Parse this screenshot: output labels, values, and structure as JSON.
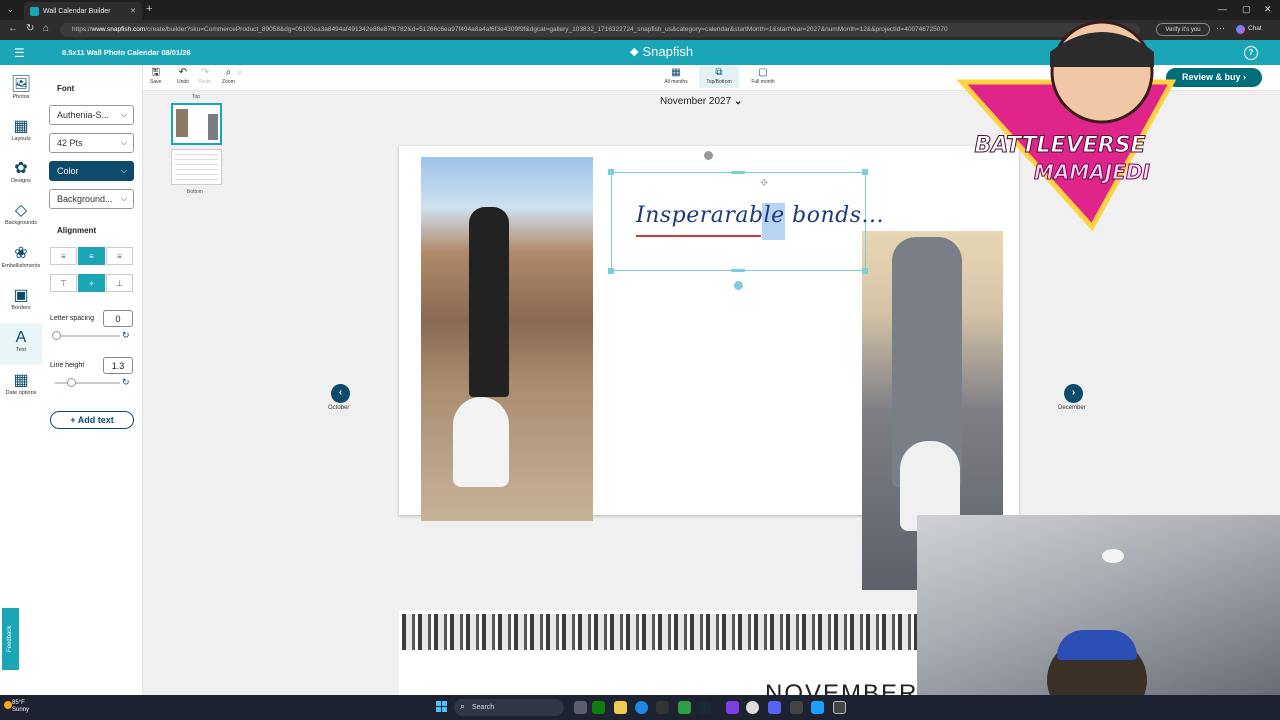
{
  "browser": {
    "tab_title": "Wall Calendar Builder",
    "url_prefix": "https://",
    "url_domain": "www.snapfish.com",
    "url_rest": "/create/builder?sku=CommerceProduct_89058&dg=05102ea3a8494af491342e88e87f6782&d=51266c6ea97f494a8a4af6f3e4309f9f&dgcat=gallery_103832_1716322724_snapfish_us&category=calendar&startMonth=1&startYear=2027&numMonth=12&&projectId=400746725070",
    "verify_label": "Verify it's you",
    "chat_label": "Chat"
  },
  "app": {
    "project_title": "8.5x11 Wall Photo Calendar  08/01/26",
    "brand": "Snapfish",
    "help_label": "?",
    "review_button": "Review & buy ›"
  },
  "rail": [
    {
      "label": "Photos",
      "icon": "photos-icon",
      "glyph": "🖼"
    },
    {
      "label": "Layouts",
      "icon": "layouts-icon",
      "glyph": "▦"
    },
    {
      "label": "Designs",
      "icon": "designs-icon",
      "glyph": "✿"
    },
    {
      "label": "Backgrounds",
      "icon": "backgrounds-icon",
      "glyph": "◇"
    },
    {
      "label": "Embellishments",
      "icon": "embellishments-icon",
      "glyph": "❀"
    },
    {
      "label": "Borders",
      "icon": "borders-icon",
      "glyph": "▣"
    },
    {
      "label": "Text",
      "icon": "text-icon",
      "glyph": "A"
    },
    {
      "label": "Date options",
      "icon": "calendar-icon",
      "glyph": "▦"
    }
  ],
  "panel": {
    "font_heading": "Font",
    "font_family": "Authenia-S...",
    "font_size": "42 Pts",
    "color_label": "Color",
    "background_label": "Background...",
    "alignment_heading": "Alignment",
    "letter_spacing_label": "Letter spacing",
    "letter_spacing_value": "0",
    "line_height_label": "Line height",
    "line_height_value": "1.3",
    "add_text": "+ Add text",
    "feedback": "Feedback"
  },
  "toolbar": {
    "save": "Save",
    "undo": "Undo",
    "redo": "Redo",
    "zoom": "Zoom",
    "views": [
      "All months",
      "Top/Bottom",
      "Full month"
    ]
  },
  "thumbnails": {
    "top": "Top",
    "bottom": "Bottom"
  },
  "canvas": {
    "month_selector": "November 2027",
    "text_content": "Insperarable bonds...",
    "prev_month": "October",
    "next_month": "December",
    "bottom_month": "NOVEMBER"
  },
  "overlay": {
    "logo_line1": "BATTLEVERSE",
    "logo_line2": "MAMAJEDI"
  },
  "taskbar": {
    "temperature": "85°F",
    "condition": "Sunny",
    "search": "Search"
  },
  "colors": {
    "teal": "#1aa6b7",
    "navy": "#0d4a6b",
    "script_text": "#1d3a7a"
  }
}
